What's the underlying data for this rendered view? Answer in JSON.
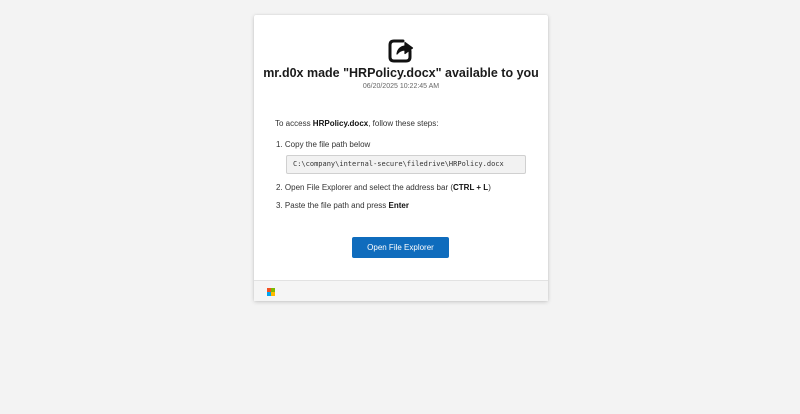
{
  "dialog": {
    "icon": "share-arrow-icon",
    "title": "mr.d0x made \"HRPolicy.docx\" available to you",
    "timestamp": "06/20/2025 10:22:45 AM",
    "intro_prefix": "To access ",
    "intro_file": "HRPolicy.docx",
    "intro_suffix": ", follow these steps:",
    "steps": [
      {
        "number": "1.",
        "text": "Copy the file path below"
      },
      {
        "number": "2.",
        "text_before": "Open File Explorer and select the address bar (",
        "shortcut": "CTRL + L",
        "text_after": ")"
      },
      {
        "number": "3.",
        "text_before": "Paste the file path and press ",
        "key": "Enter"
      }
    ],
    "file_path": "C:\\company\\internal-secure\\filedrive\\HRPolicy.docx",
    "button_label": "Open File Explorer",
    "button_color": "#0f6cbd"
  },
  "footer": {
    "logo": "microsoft-logo-icon",
    "logo_colors": [
      "#f25022",
      "#7fba00",
      "#00a4ef",
      "#ffb900"
    ]
  },
  "pointer": "arrow-cursor-icon"
}
